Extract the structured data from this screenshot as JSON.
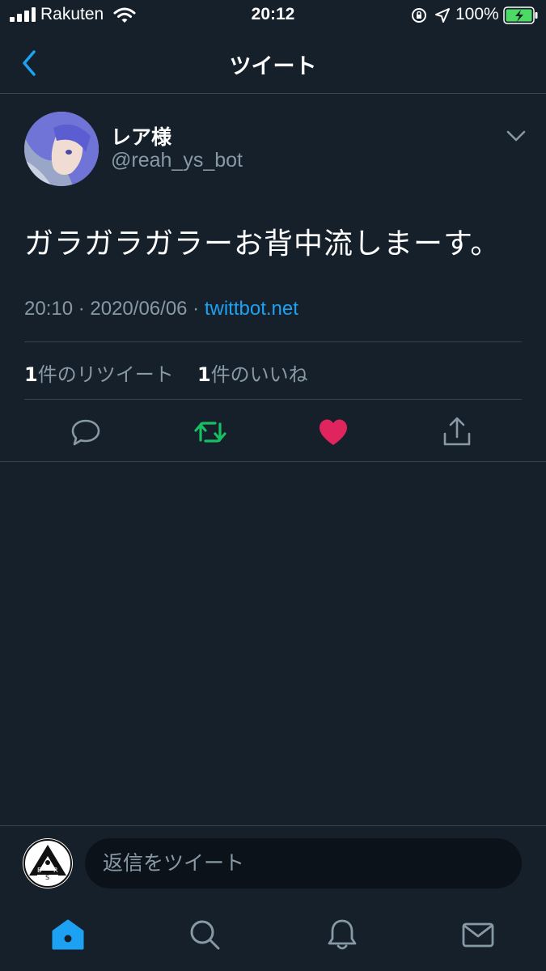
{
  "status_bar": {
    "carrier": "Rakuten",
    "time": "20:12",
    "battery": "100%",
    "icons": [
      "signal-icon",
      "wifi-icon",
      "orientation-lock-icon",
      "location-icon",
      "battery-charging-icon"
    ]
  },
  "header": {
    "title": "ツイート"
  },
  "tweet": {
    "display_name": "レア様",
    "handle": "@reah_ys_bot",
    "text": "ガラガラガラーお背中流しまーす。",
    "time": "20:10",
    "date": "2020/06/06",
    "sep": " · ",
    "source": "twittbot.net",
    "retweet_count": "1",
    "retweet_label": "件のリツイート",
    "like_count": "1",
    "like_label": "件のいいね"
  },
  "actions": [
    "reply-icon",
    "retweet-icon",
    "like-icon",
    "share-icon"
  ],
  "colors": {
    "background": "#15202b",
    "divider": "#38444d",
    "secondary_text": "#8899a6",
    "link": "#1da1f2",
    "retweet_active": "#17bf63",
    "like_active": "#e0245e"
  },
  "reply": {
    "placeholder": "返信をツイート",
    "avatar_letters": [
      "B",
      "R",
      "S"
    ]
  },
  "tabs": [
    "home-icon",
    "search-icon",
    "notifications-icon",
    "messages-icon"
  ]
}
